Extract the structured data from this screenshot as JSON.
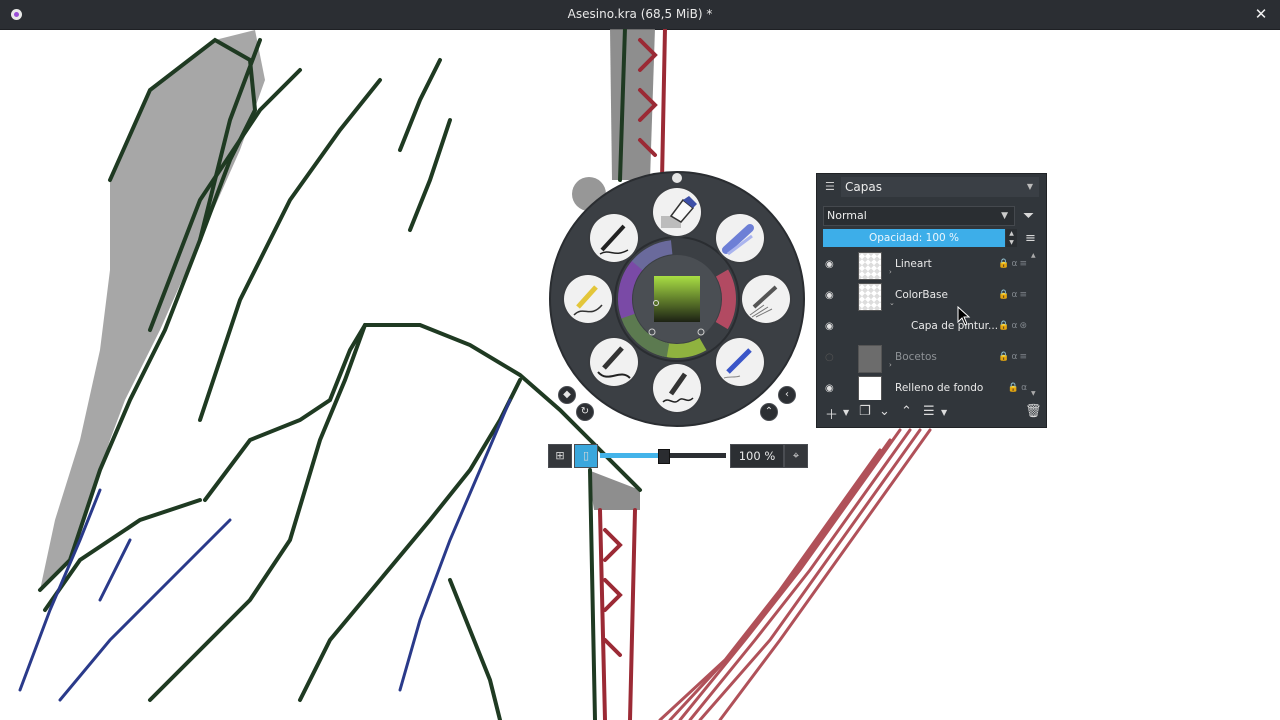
{
  "window": {
    "title": "Asesino.kra (68,5 MiB) *",
    "close_label": "✕"
  },
  "palette": {
    "brushes": [
      "ink-pen",
      "eraser",
      "marker-blue",
      "pencil-yellow",
      "pencil-gray",
      "ink-brush",
      "ink-calligraphy",
      "pencil-blue"
    ],
    "zoom": {
      "value_label": "100 %",
      "slider_level": 0.5
    }
  },
  "layers_docker": {
    "title": "Capas",
    "blend_mode": "Normal",
    "opacity_label": "Opacidad: 100 %",
    "layers": [
      {
        "name": "Lineart",
        "visible": true,
        "thumb": "checker",
        "dim": false
      },
      {
        "name": "ColorBase",
        "visible": true,
        "thumb": "checker",
        "dim": false
      },
      {
        "name": "Capa de pintur...",
        "visible": true,
        "thumb": "none",
        "dim": false
      },
      {
        "name": "Bocetos",
        "visible": false,
        "thumb": "gray",
        "dim": true
      },
      {
        "name": "Relleno de fondo",
        "visible": true,
        "thumb": "white",
        "dim": false
      }
    ]
  },
  "colors": {
    "accent": "#3daee9",
    "dock_bg": "#31363b",
    "titlebar_bg": "#2b2e33"
  }
}
